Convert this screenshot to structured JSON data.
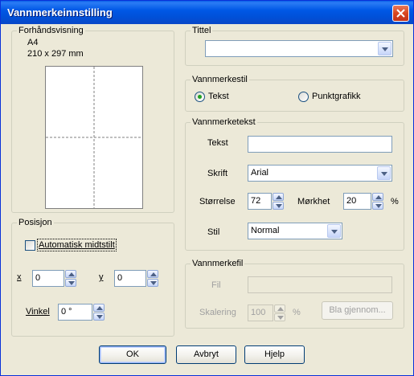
{
  "window": {
    "title": "Vannmerkeinnstilling"
  },
  "preview": {
    "group": "Forhåndsvisning",
    "paper": "A4",
    "dims": "210 x 297 mm"
  },
  "position": {
    "group": "Posisjon",
    "auto_center_label": "Automatisk midtstilt",
    "x_label": "x",
    "x_value": "0",
    "y_label": "y",
    "y_value": "0",
    "angle_label": "Vinkel",
    "angle_value": "0 °"
  },
  "title_group": {
    "group": "Tittel",
    "value": ""
  },
  "style_group": {
    "group": "Vannmerkestil",
    "text_option": "Tekst",
    "bitmap_option": "Punktgrafikk",
    "selected": "Tekst"
  },
  "text_group": {
    "group": "Vannmerketekst",
    "text_label": "Tekst",
    "text_value": "",
    "font_label": "Skrift",
    "font_value": "Arial",
    "size_label": "Størrelse",
    "size_value": "72",
    "darkness_label": "Mørkhet",
    "darkness_value": "20",
    "darkness_unit": "%",
    "style_label": "Stil",
    "style_value": "Normal"
  },
  "file_group": {
    "group": "Vannmerkefil",
    "file_label": "Fil",
    "file_value": "",
    "scale_label": "Skalering",
    "scale_value": "100",
    "scale_unit": "%",
    "browse_label": "Bla gjennom..."
  },
  "buttons": {
    "ok": "OK",
    "cancel": "Avbryt",
    "help": "Hjelp"
  },
  "colors": {
    "titlebar": "#0058E6",
    "dialog_bg": "#ECE9D8",
    "close": "#D9471F",
    "radio_dot": "#21A121"
  }
}
